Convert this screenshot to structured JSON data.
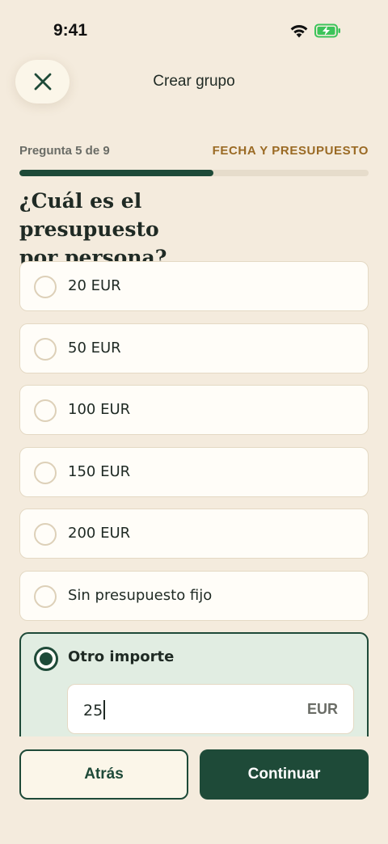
{
  "status_bar": {
    "time": "9:41",
    "icons": [
      "wifi-icon",
      "battery-charging-icon"
    ],
    "battery_color": "#3cc45a"
  },
  "nav": {
    "title": "Crear grupo",
    "close_icon": "close-icon"
  },
  "progress": {
    "step_label": "Pregunta 5 de 9",
    "section_label": "FECHA Y PRESUPUESTO",
    "fraction": 0.556
  },
  "question": {
    "title_line1": "¿Cuál es el presupuesto",
    "title_line2": "por persona?"
  },
  "options": [
    {
      "label": "20 EUR",
      "selected": false
    },
    {
      "label": "50 EUR",
      "selected": false
    },
    {
      "label": "100 EUR",
      "selected": false
    },
    {
      "label": "150 EUR",
      "selected": false
    },
    {
      "label": "200 EUR",
      "selected": false
    },
    {
      "label": "Sin presupuesto fijo",
      "selected": false
    }
  ],
  "custom_option": {
    "label": "Otro importe",
    "selected": true,
    "amount_value": "25",
    "unit": "EUR"
  },
  "footer": {
    "back_label": "Atrás",
    "continue_label": "Continuar"
  },
  "colors": {
    "background": "#f4ebdd",
    "primary": "#1e4a38",
    "accent": "#9a6a24",
    "selected_bg": "#e1ede2"
  }
}
